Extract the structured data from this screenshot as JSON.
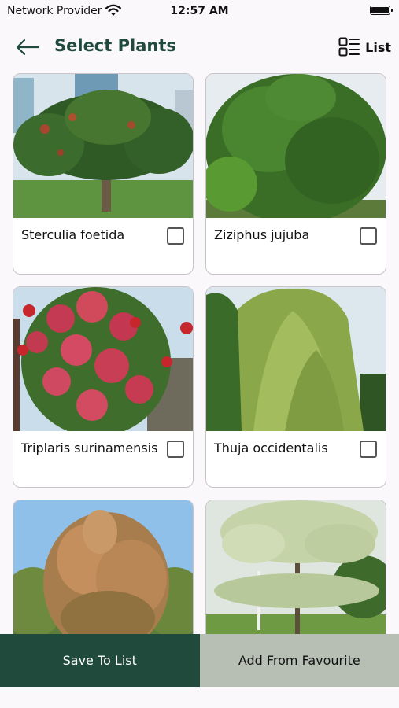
{
  "status_bar": {
    "carrier": "Network Provider",
    "time": "12:57 AM"
  },
  "header": {
    "title": "Select Plants",
    "view_toggle_label": "List"
  },
  "plants": [
    {
      "name": "Sterculia foetida",
      "checked": false
    },
    {
      "name": "Ziziphus jujuba",
      "checked": false
    },
    {
      "name": "Triplaris surinamensis",
      "checked": false
    },
    {
      "name": "Thuja occidentalis",
      "checked": false
    },
    {
      "name": "",
      "checked": false
    },
    {
      "name": "",
      "checked": false
    }
  ],
  "footer": {
    "save_label": "Save To List",
    "favourite_label": "Add From Favourite"
  },
  "colors": {
    "primary": "#1f4a3c",
    "secondary": "#b7beb3",
    "background": "#fbf8fb"
  }
}
